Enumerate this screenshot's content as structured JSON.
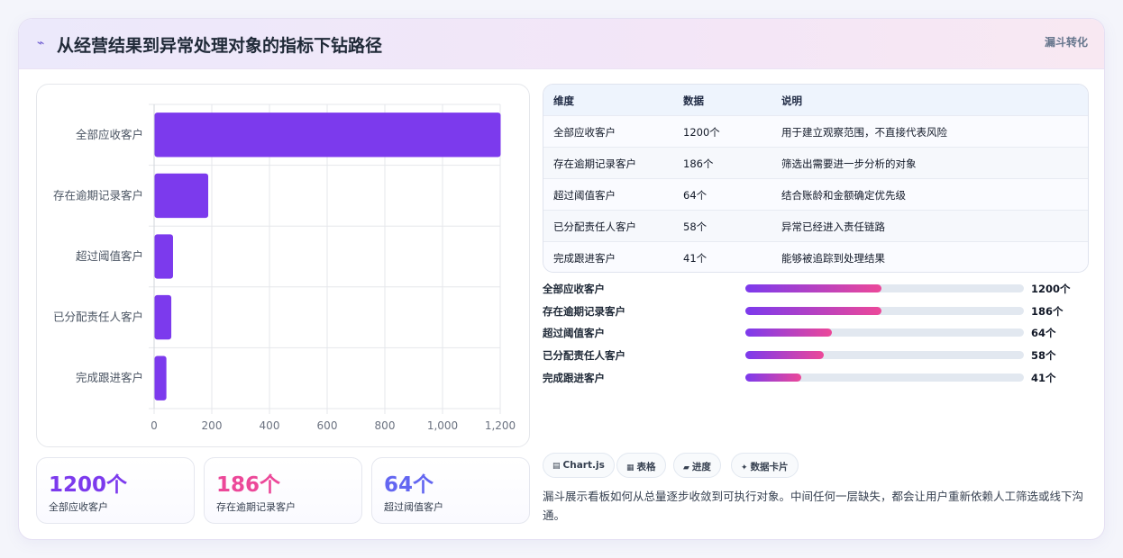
{
  "header": {
    "title": "从经营结果到异常处理对象的指标下钻路径",
    "tag": "漏斗转化",
    "icon": "trend-line-icon"
  },
  "chart_data": {
    "type": "bar",
    "orientation": "horizontal",
    "categories": [
      "全部应收客户",
      "存在逾期记录客户",
      "超过阈值客户",
      "已分配责任人客户",
      "完成跟进客户"
    ],
    "values": [
      1200,
      186,
      64,
      58,
      41
    ],
    "xlim": [
      0,
      1200
    ],
    "xticks": [
      "0",
      "200",
      "400",
      "600",
      "800",
      "1,000",
      "1,200"
    ],
    "bar_color": "#7c3aed",
    "grid": true
  },
  "kpis": [
    {
      "value": "1200个",
      "label": "全部应收客户",
      "color": "#7c3aed"
    },
    {
      "value": "186个",
      "label": "存在逾期记录客户",
      "color": "#ec4899"
    },
    {
      "value": "64个",
      "label": "超过阈值客户",
      "color": "#6366f1"
    }
  ],
  "table": {
    "headers": [
      "维度",
      "数据",
      "说明"
    ],
    "rows": [
      [
        "全部应收客户",
        "1200个",
        "用于建立观察范围，不直接代表风险"
      ],
      [
        "存在逾期记录客户",
        "186个",
        "筛选出需要进一步分析的对象"
      ],
      [
        "超过阈值客户",
        "64个",
        "结合账龄和金额确定优先级"
      ],
      [
        "已分配责任人客户",
        "58个",
        "异常已经进入责任链路"
      ],
      [
        "完成跟进客户",
        "41个",
        "能够被追踪到处理结果"
      ]
    ]
  },
  "progress": [
    {
      "label": "全部应收客户",
      "value": "1200个",
      "fill": 0.49
    },
    {
      "label": "存在逾期记录客户",
      "value": "186个",
      "fill": 0.49
    },
    {
      "label": "超过阈值客户",
      "value": "64个",
      "fill": 0.31
    },
    {
      "label": "已分配责任人客户",
      "value": "58个",
      "fill": 0.28
    },
    {
      "label": "完成跟进客户",
      "value": "41个",
      "fill": 0.2
    }
  ],
  "chips": [
    {
      "label": "Chart.js",
      "icon": "chart-icon"
    },
    {
      "label": "表格",
      "icon": "table-icon"
    },
    {
      "label": "进度",
      "icon": "progress-icon"
    },
    {
      "label": "数据卡片",
      "icon": "card-icon"
    }
  ],
  "note": "漏斗展示看板如何从总量逐步收敛到可执行对象。中间任何一层缺失，都会让用户重新依赖人工筛选或线下沟通。"
}
